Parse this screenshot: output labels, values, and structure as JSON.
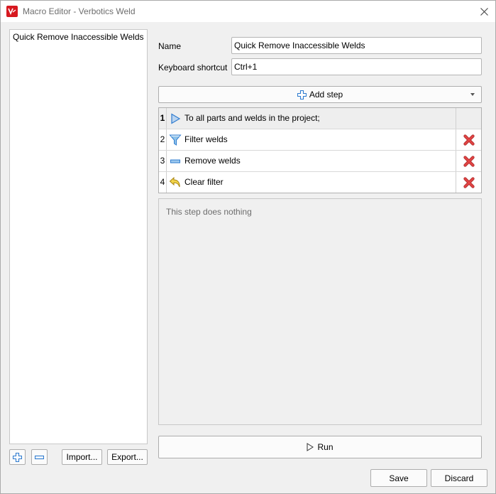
{
  "window": {
    "title": "Macro Editor - Verbotics Weld"
  },
  "macros": [
    {
      "label": "Quick Remove Inaccessible Welds"
    }
  ],
  "form": {
    "name_label": "Name",
    "name_value": "Quick Remove Inaccessible Welds",
    "shortcut_label": "Keyboard shortcut",
    "shortcut_value": "Ctrl+1"
  },
  "add_step": {
    "label": "Add step"
  },
  "steps": [
    {
      "num": "1",
      "label": "To all parts and welds in the project;",
      "icon": "play-triangle-icon",
      "deletable": false
    },
    {
      "num": "2",
      "label": "Filter welds",
      "icon": "funnel-icon",
      "deletable": true
    },
    {
      "num": "3",
      "label": "Remove welds",
      "icon": "minus-bar-icon",
      "deletable": true
    },
    {
      "num": "4",
      "label": "Clear filter",
      "icon": "undo-arrow-icon",
      "deletable": true
    }
  ],
  "description": "This step does nothing",
  "buttons": {
    "import": "Import...",
    "export": "Export...",
    "run": "Run",
    "save": "Save",
    "discard": "Discard"
  },
  "colors": {
    "accent_blue": "#2e7bcf",
    "delete_red": "#d9322f",
    "brand_red": "#d71920"
  }
}
